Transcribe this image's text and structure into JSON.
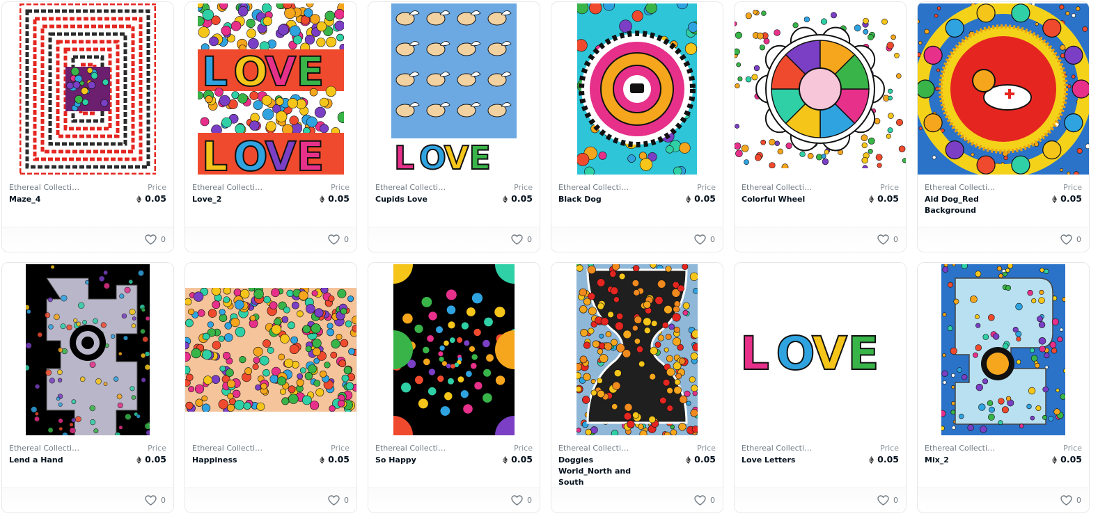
{
  "price_label": "Price",
  "icons": {
    "currency": "eth-icon",
    "favorite": "heart-icon"
  },
  "cards": [
    {
      "collection": "Ethereal Collectio...",
      "name": "Maze_4",
      "price": "0.05",
      "favorites": "0",
      "art": "maze",
      "colors": [
        "#e52620",
        "#2b2b2b",
        "#ffffff"
      ]
    },
    {
      "collection": "Ethereal Collectio...",
      "name": "Love_2",
      "price": "0.05",
      "favorites": "0",
      "art": "love-bands",
      "colors": [
        "#f04a2e",
        "#2fa3e0",
        "#f5c51a"
      ]
    },
    {
      "collection": "Ethereal Collectio...",
      "name": "Cupids Love",
      "price": "0.05",
      "favorites": "0",
      "art": "cupids",
      "colors": [
        "#6ca9e2",
        "#f3d2a2",
        "#e63a7a"
      ]
    },
    {
      "collection": "Ethereal Collectio...",
      "name": "Black Dog",
      "price": "0.05",
      "favorites": "0",
      "art": "mandala",
      "colors": [
        "#2ec5d8",
        "#e6308a",
        "#f5a61c"
      ]
    },
    {
      "collection": "Ethereal Collectio...",
      "name": "Colorful Wheel",
      "price": "0.05",
      "favorites": "0",
      "art": "wheel",
      "colors": [
        "#f5c51a",
        "#2fa3e0",
        "#e6308a"
      ]
    },
    {
      "collection": "Ethereal Collectio...",
      "name": "Aid Dog_Red Background",
      "price": "0.05",
      "favorites": "0",
      "art": "aid-dog",
      "colors": [
        "#e52620",
        "#2a73c9",
        "#f5d21a"
      ]
    },
    {
      "collection": "Ethereal Collectio...",
      "name": "Lend a Hand",
      "price": "0.05",
      "favorites": "0",
      "art": "hand",
      "colors": [
        "#000000",
        "#b8b6c8",
        "#e6308a"
      ]
    },
    {
      "collection": "Ethereal Collectio...",
      "name": "Happiness",
      "price": "0.05",
      "favorites": "0",
      "art": "happiness",
      "colors": [
        "#f5c49a",
        "#7a3fc4",
        "#e6308a"
      ]
    },
    {
      "collection": "Ethereal Collectio...",
      "name": "So Happy",
      "price": "0.05",
      "favorites": "0",
      "art": "spiral",
      "colors": [
        "#000000",
        "#2fd0a6",
        "#f23a8a"
      ]
    },
    {
      "collection": "Ethereal Collectio...",
      "name": "Doggies World_North and South",
      "price": "0.05",
      "favorites": "0",
      "art": "hourglass",
      "colors": [
        "#f08a1e",
        "#1f1f1f",
        "#2fa3e0"
      ]
    },
    {
      "collection": "Ethereal Collectio...",
      "name": "Love Letters",
      "price": "0.05",
      "favorites": "0",
      "art": "love-letters",
      "colors": [
        "#e6308a",
        "#2fa3e0",
        "#f5c51a"
      ]
    },
    {
      "collection": "Ethereal Collectio...",
      "name": "Mix_2",
      "price": "0.05",
      "favorites": "0",
      "art": "mix",
      "colors": [
        "#2a73c9",
        "#f5a61c",
        "#e52620"
      ]
    }
  ]
}
